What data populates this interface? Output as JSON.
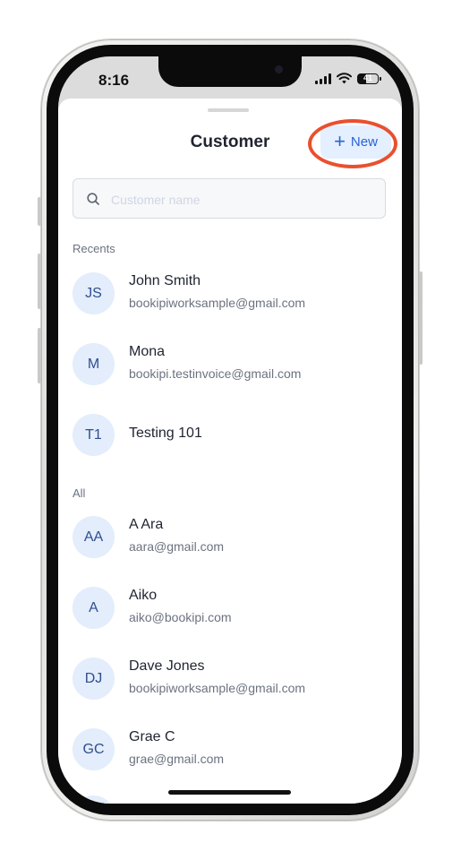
{
  "status_bar": {
    "time": "8:16",
    "battery": "41"
  },
  "header": {
    "title": "Customer",
    "new_button_label": "New"
  },
  "search": {
    "placeholder": "Customer name",
    "value": ""
  },
  "recents": {
    "label": "Recents",
    "items": [
      {
        "initials": "JS",
        "name": "John Smith",
        "email": "bookipiworksample@gmail.com"
      },
      {
        "initials": "M",
        "name": "Mona",
        "email": "bookipi.testinvoice@gmail.com"
      },
      {
        "initials": "T1",
        "name": "Testing 101",
        "email": ""
      }
    ]
  },
  "all": {
    "label": "All",
    "items": [
      {
        "initials": "AA",
        "name": "A Ara",
        "email": "aara@gmail.com"
      },
      {
        "initials": "A",
        "name": "Aiko",
        "email": "aiko@bookipi.com"
      },
      {
        "initials": "DJ",
        "name": "Dave Jones",
        "email": "bookipiworksample@gmail.com"
      },
      {
        "initials": "GC",
        "name": "Grae C",
        "email": "grae@gmail.com"
      }
    ]
  },
  "colors": {
    "accent": "#2a63d4",
    "button_bg": "#e4efff",
    "avatar_bg": "#e3edfb",
    "highlight": "#e9502e"
  },
  "icons": [
    "search-icon",
    "plus-icon",
    "signal-icon",
    "wifi-icon",
    "battery-icon"
  ]
}
